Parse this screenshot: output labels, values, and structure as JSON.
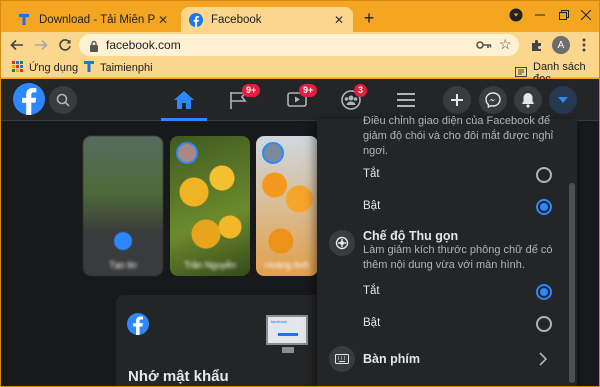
{
  "browser": {
    "tabs": [
      {
        "title": "Download - Tải Miễn Phí VN - Ph",
        "active": false
      },
      {
        "title": "Facebook",
        "active": true
      }
    ],
    "url": "facebook.com",
    "profile_initial": "A",
    "bookmarks": [
      {
        "label": "Ứng dụng",
        "icon": "apps-grid-icon"
      },
      {
        "label": "Taimienphi",
        "icon": "taimienphi-icon"
      }
    ],
    "reading_list": "Danh sách đọc",
    "accent_color": "#f4a623"
  },
  "facebook": {
    "badges": {
      "pages": "9+",
      "watch": "9+",
      "groups": "3"
    },
    "stories": [
      {
        "label": "Tạo tin"
      },
      {
        "label": "Trần Nguyễn"
      },
      {
        "label": "Hoàng Anh"
      }
    ],
    "card_title": "Nhớ mật khẩu",
    "card_brand": "facebook"
  },
  "menu": {
    "dark_mode_desc": "Điều chỉnh giao diện của Facebook để giảm độ chói và cho đôi mắt được nghỉ ngơi.",
    "dark_off": "Tắt",
    "dark_on": "Bật",
    "compact_title": "Chế độ Thu gọn",
    "compact_desc": "Làm giảm kích thước phông chữ để có thêm nội dung vừa với màn hình.",
    "compact_off": "Tắt",
    "compact_on": "Bật",
    "keyboard": "Bàn phím",
    "dark_mode_selected": "Bật",
    "compact_selected": "Tắt"
  }
}
